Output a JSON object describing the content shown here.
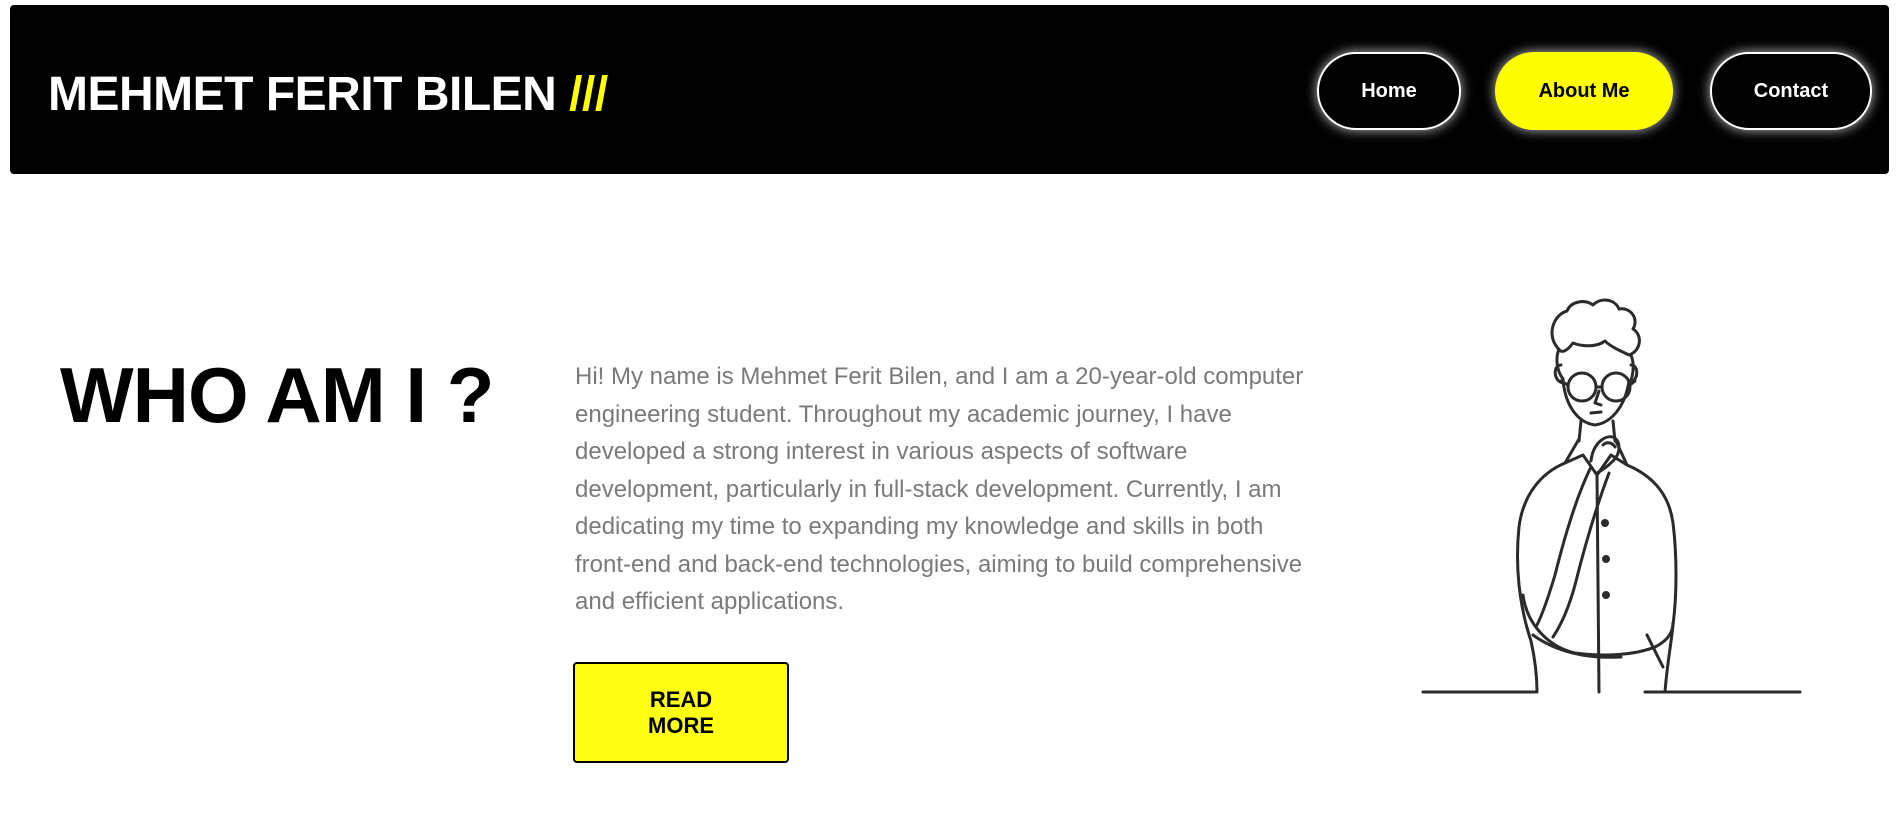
{
  "header": {
    "brand_name": "MEHMET FERIT BILEN",
    "brand_suffix": "///",
    "nav": {
      "home": "Home",
      "about": "About Me",
      "contact": "Contact"
    },
    "active_nav": "about"
  },
  "main": {
    "heading": "WHO AM I ?",
    "about_text": "Hi! My name is Mehmet Ferit Bilen, and I am a 20-year-old computer engineering student. Throughout my academic journey, I have developed a strong interest in various aspects of software development, particularly in full-stack development. Currently, I am dedicating my time to expanding my knowledge and skills in both front-end and back-end technologies, aiming to build comprehensive and efficient applications.",
    "read_more_label": "READ MORE",
    "illustration_icon": "thinking-person-illustration"
  },
  "colors": {
    "accent": "#ffff00",
    "navbar_bg": "#000000",
    "text_muted": "#7a7a7a"
  }
}
